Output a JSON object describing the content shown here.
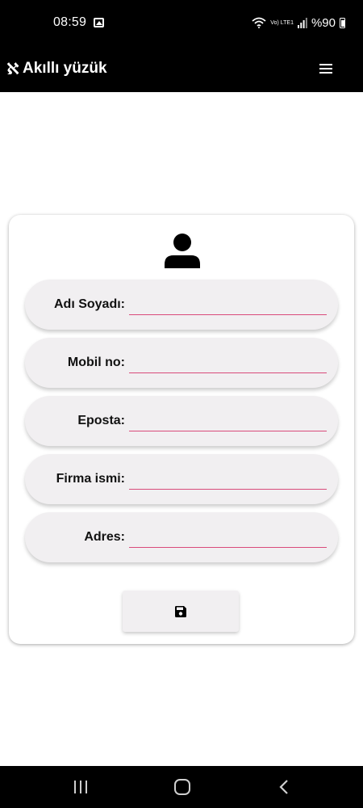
{
  "status_bar": {
    "time": "08:59",
    "network": "Vo) LTE1",
    "battery_text": "%90",
    "icons": [
      "image-icon",
      "wifi-icon",
      "signal-icon",
      "battery-icon"
    ]
  },
  "app_bar": {
    "title": "Akıllı yüzük",
    "logo_glyph": "ℵ",
    "icons": [
      "logo-icon",
      "menu-icon"
    ]
  },
  "form": {
    "avatar_icon": "person-icon",
    "fields": [
      {
        "label": "Adı Soyadı:",
        "value": "",
        "placeholder": ""
      },
      {
        "label": "Mobil no:",
        "value": "",
        "placeholder": ""
      },
      {
        "label": "Eposta:",
        "value": "",
        "placeholder": ""
      },
      {
        "label": "Firma ismi:",
        "value": "",
        "placeholder": ""
      },
      {
        "label": "Adres:",
        "value": "",
        "placeholder": ""
      }
    ],
    "save_icon": "save-icon"
  },
  "nav_bar": {
    "icons": [
      "recents-icon",
      "home-icon",
      "back-icon"
    ]
  },
  "colors": {
    "bar_background": "#000000",
    "field_background": "#f1eff1",
    "underline": "#d94a7a"
  }
}
